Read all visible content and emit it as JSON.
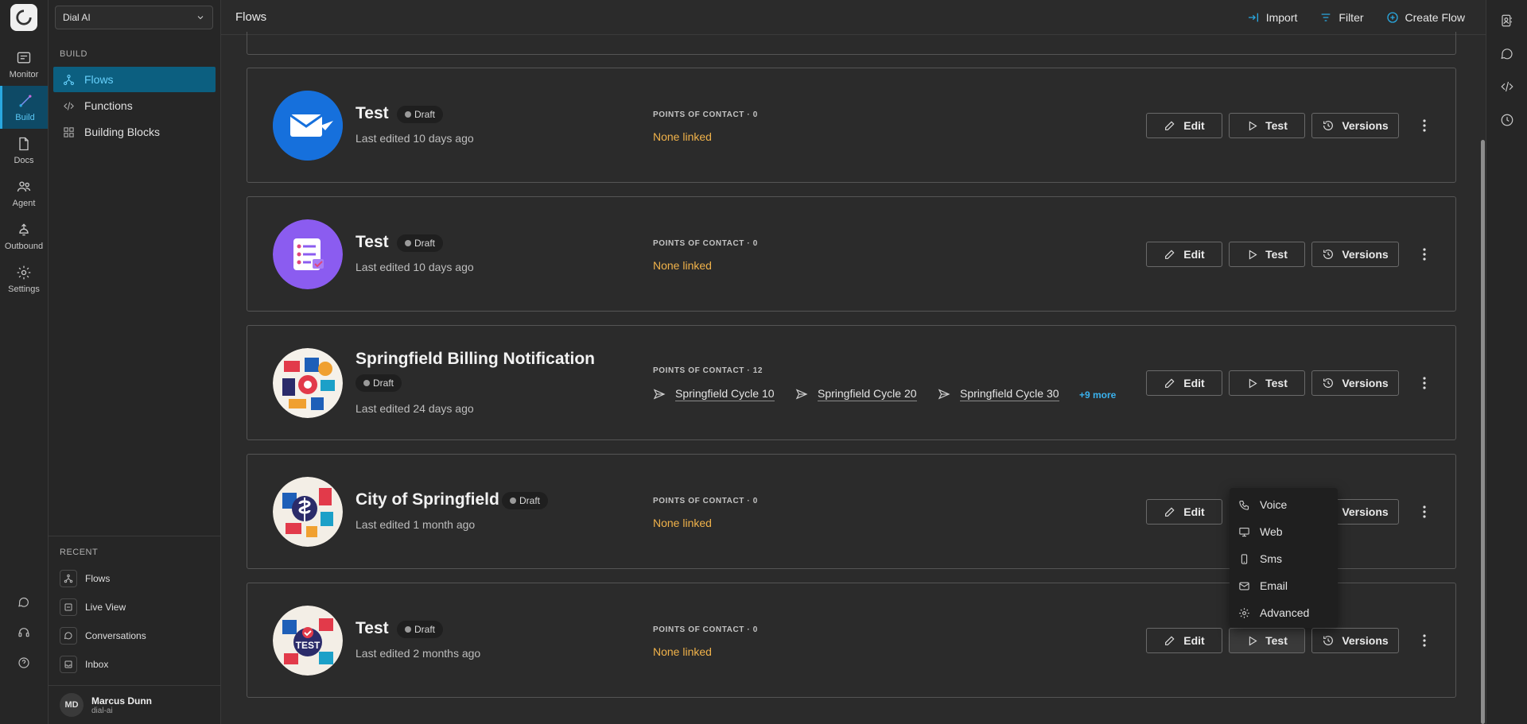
{
  "app": {
    "workspace": "Dial AI",
    "page_title": "Flows"
  },
  "rail": [
    {
      "label": "Monitor",
      "icon": "monitor-icon"
    },
    {
      "label": "Build",
      "icon": "build-icon",
      "active": true
    },
    {
      "label": "Docs",
      "icon": "docs-icon"
    },
    {
      "label": "Agent",
      "icon": "agent-icon"
    },
    {
      "label": "Outbound",
      "icon": "outbound-icon"
    },
    {
      "label": "Settings",
      "icon": "gear-icon"
    }
  ],
  "sidenav": {
    "build_label": "BUILD",
    "items": [
      {
        "label": "Flows",
        "active": true
      },
      {
        "label": "Functions"
      },
      {
        "label": "Building Blocks"
      }
    ],
    "recent_label": "RECENT",
    "recent": [
      {
        "label": "Flows"
      },
      {
        "label": "Live View"
      },
      {
        "label": "Conversations"
      },
      {
        "label": "Inbox"
      }
    ]
  },
  "user": {
    "initials": "MD",
    "name": "Marcus Dunn",
    "org": "dial-ai"
  },
  "header": {
    "import_label": "Import",
    "filter_label": "Filter",
    "create_label": "Create Flow"
  },
  "flows": [
    {
      "name": "Test",
      "status": "Draft",
      "edited": "Last edited 10 days ago",
      "poc_label": "POINTS OF CONTACT · 0",
      "none": "None linked"
    },
    {
      "name": "Test",
      "status": "Draft",
      "edited": "Last edited 10 days ago",
      "poc_label": "POINTS OF CONTACT · 0",
      "none": "None linked"
    },
    {
      "name": "Springfield Billing Notification",
      "status": "Draft",
      "edited": "Last edited 24 days ago",
      "poc_label": "POINTS OF CONTACT · 12",
      "contacts": [
        "Springfield Cycle 10",
        "Springfield Cycle 20",
        "Springfield Cycle 30"
      ],
      "more": "+9 more"
    },
    {
      "name": "City of Springfield",
      "status": "Draft",
      "edited": "Last edited 1 month ago",
      "poc_label": "POINTS OF CONTACT · 0",
      "none": "None linked"
    },
    {
      "name": "Test",
      "status": "Draft",
      "edited": "Last edited 2 months ago",
      "poc_label": "POINTS OF CONTACT · 0",
      "none": "None linked"
    }
  ],
  "actions": {
    "edit": "Edit",
    "test": "Test",
    "versions": "Versions"
  },
  "test_menu": [
    "Voice",
    "Web",
    "Sms",
    "Email",
    "Advanced"
  ],
  "colors": {
    "accent": "#29a8e0",
    "active_bg": "#0c5f80",
    "warning": "#f0b24a",
    "link": "#3ab2ee"
  }
}
